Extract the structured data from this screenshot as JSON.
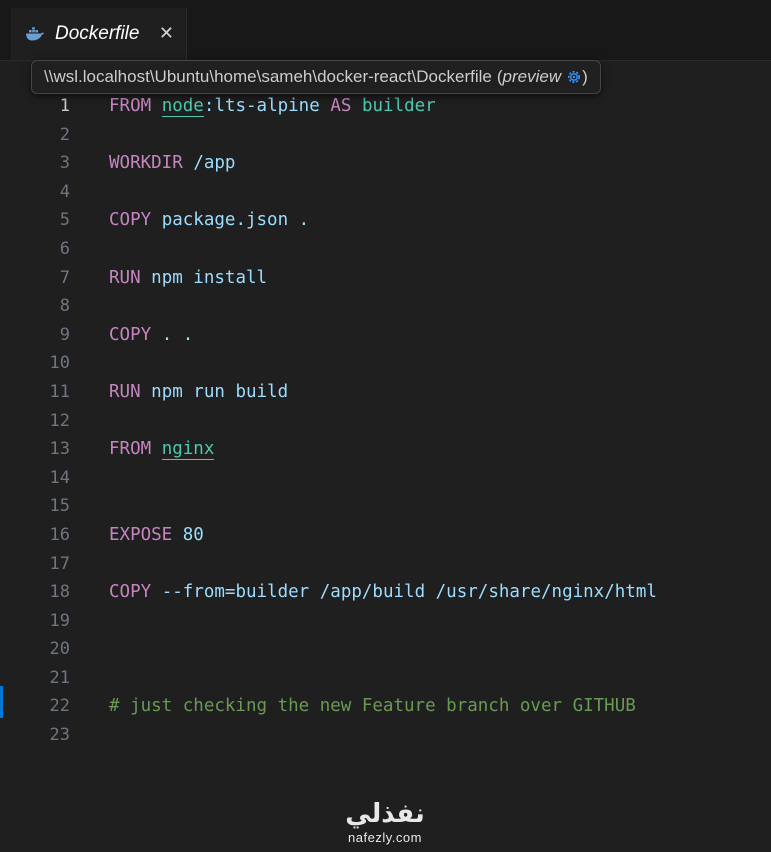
{
  "tab": {
    "icon": "docker-whale-icon",
    "title": "Dockerfile",
    "close_glyph": "✕"
  },
  "tooltip": {
    "path": "\\\\wsl.localhost\\Ubuntu\\home\\sameh\\docker-react\\Dockerfile",
    "open_paren": "(",
    "preview_label": "preview",
    "close_paren": ")",
    "gear_icon": "gear-icon"
  },
  "editor": {
    "active_line": 1,
    "colors": {
      "keyword": "#c586c0",
      "argument": "#9cdcfe",
      "image": "#4ec9b0",
      "number": "#b5cea8",
      "comment": "#6a9955"
    },
    "lines": [
      {
        "n": "1",
        "tokens": [
          {
            "t": "FROM",
            "c": "kw"
          },
          {
            "t": " "
          },
          {
            "t": "node",
            "c": "img"
          },
          {
            "t": ":lts-alpine",
            "c": "tag"
          },
          {
            "t": " "
          },
          {
            "t": "AS",
            "c": "kw"
          },
          {
            "t": " "
          },
          {
            "t": "builder",
            "c": "alias"
          }
        ]
      },
      {
        "n": "2",
        "tokens": []
      },
      {
        "n": "3",
        "tokens": [
          {
            "t": "WORKDIR",
            "c": "kw"
          },
          {
            "t": " "
          },
          {
            "t": "/app",
            "c": "arg"
          }
        ]
      },
      {
        "n": "4",
        "tokens": []
      },
      {
        "n": "5",
        "tokens": [
          {
            "t": "COPY",
            "c": "kw"
          },
          {
            "t": " "
          },
          {
            "t": "package.json .",
            "c": "arg"
          }
        ]
      },
      {
        "n": "6",
        "tokens": []
      },
      {
        "n": "7",
        "tokens": [
          {
            "t": "RUN",
            "c": "kw"
          },
          {
            "t": " "
          },
          {
            "t": "npm install",
            "c": "arg"
          }
        ]
      },
      {
        "n": "8",
        "tokens": []
      },
      {
        "n": "9",
        "tokens": [
          {
            "t": "COPY",
            "c": "kw"
          },
          {
            "t": " "
          },
          {
            "t": ". .",
            "c": "arg"
          }
        ]
      },
      {
        "n": "10",
        "tokens": []
      },
      {
        "n": "11",
        "tokens": [
          {
            "t": "RUN",
            "c": "kw"
          },
          {
            "t": " "
          },
          {
            "t": "npm run build",
            "c": "arg"
          }
        ]
      },
      {
        "n": "12",
        "tokens": []
      },
      {
        "n": "13",
        "tokens": [
          {
            "t": "FROM",
            "c": "kw"
          },
          {
            "t": " "
          },
          {
            "t": "nginx",
            "c": "img"
          }
        ]
      },
      {
        "n": "14",
        "tokens": []
      },
      {
        "n": "15",
        "tokens": []
      },
      {
        "n": "16",
        "tokens": [
          {
            "t": "EXPOSE",
            "c": "kw"
          },
          {
            "t": " "
          },
          {
            "t": "80",
            "c": "arg"
          }
        ]
      },
      {
        "n": "17",
        "tokens": []
      },
      {
        "n": "18",
        "tokens": [
          {
            "t": "COPY",
            "c": "kw"
          },
          {
            "t": " "
          },
          {
            "t": "--from=builder /app/build /usr/share/nginx/html",
            "c": "arg"
          }
        ]
      },
      {
        "n": "19",
        "tokens": []
      },
      {
        "n": "20",
        "tokens": []
      },
      {
        "n": "21",
        "tokens": []
      },
      {
        "n": "22",
        "tokens": [
          {
            "t": "# just checking the new Feature branch over GITHUB",
            "c": "comment"
          }
        ]
      },
      {
        "n": "23",
        "tokens": []
      }
    ]
  },
  "watermark": {
    "logo_text": "نفذلي",
    "domain": "nafezly.com"
  }
}
